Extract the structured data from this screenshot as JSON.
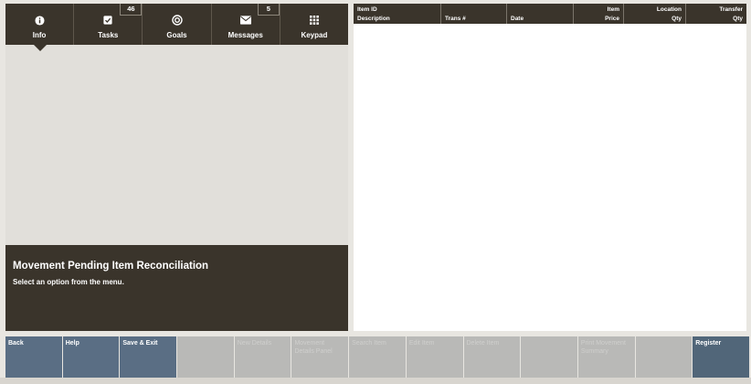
{
  "tabs": [
    {
      "label": "Info",
      "icon": "info-icon",
      "badge": null
    },
    {
      "label": "Tasks",
      "icon": "checkbox-icon",
      "badge": "46"
    },
    {
      "label": "Goals",
      "icon": "target-icon",
      "badge": null
    },
    {
      "label": "Messages",
      "icon": "envelope-icon",
      "badge": "5"
    },
    {
      "label": "Keypad",
      "icon": "keypad-icon",
      "badge": null
    }
  ],
  "message": {
    "title": "Movement Pending Item  Reconciliation",
    "subtitle": "Select an option from the menu."
  },
  "table": {
    "columns": [
      {
        "line1": "Item ID",
        "line2": "Description"
      },
      {
        "line1": "",
        "line2": "Trans #"
      },
      {
        "line1": "",
        "line2": "Date"
      },
      {
        "line1": "Item",
        "line2": "Price"
      },
      {
        "line1": "Location",
        "line2": "Qty"
      },
      {
        "line1": "Transfer",
        "line2": "Qty"
      }
    ],
    "rows": []
  },
  "buttons": [
    {
      "label": "Back",
      "state": "active"
    },
    {
      "label": "Help",
      "state": "active"
    },
    {
      "label": "Save & Exit",
      "state": "active"
    },
    {
      "label": "",
      "state": "disabled"
    },
    {
      "label": "New Details",
      "state": "disabled"
    },
    {
      "label": "Movement Details Panel",
      "state": "disabled"
    },
    {
      "label": "Search Item",
      "state": "disabled"
    },
    {
      "label": "Edit Item",
      "state": "disabled"
    },
    {
      "label": "Delete Item",
      "state": "disabled"
    },
    {
      "label": "",
      "state": "disabled"
    },
    {
      "label": "Print Movement Summary",
      "state": "disabled"
    },
    {
      "label": "",
      "state": "disabled"
    },
    {
      "label": "Register",
      "state": "active"
    }
  ],
  "colors": {
    "dark_panel": "#3a342b",
    "button_active": "#5a6e84",
    "button_disabled": "#b9b9b7"
  }
}
